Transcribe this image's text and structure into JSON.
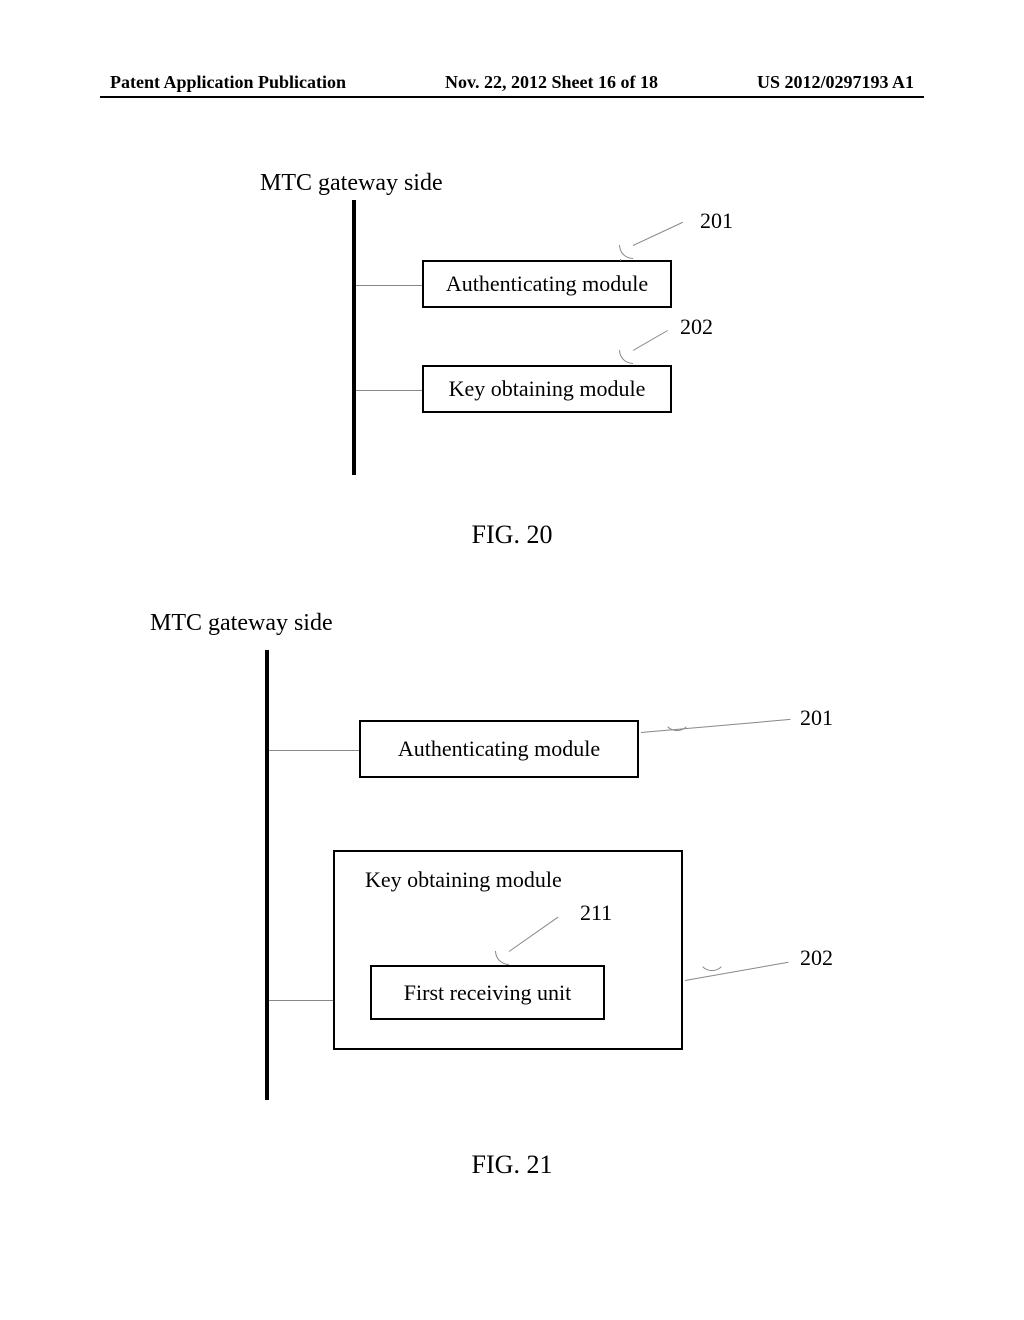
{
  "header": {
    "left": "Patent Application Publication",
    "center": "Nov. 22, 2012  Sheet 16 of 18",
    "right": "US 2012/0297193 A1"
  },
  "fig20": {
    "title": "MTC gateway side",
    "box1": "Authenticating module",
    "box2": "Key obtaining module",
    "ref1": "201",
    "ref2": "202",
    "caption": "FIG. 20"
  },
  "fig21": {
    "title": "MTC gateway side",
    "box1": "Authenticating module",
    "box2_label": "Key obtaining module",
    "box3": "First receiving unit",
    "ref1": "201",
    "ref2": "202",
    "ref3": "211",
    "caption": "FIG. 21"
  }
}
